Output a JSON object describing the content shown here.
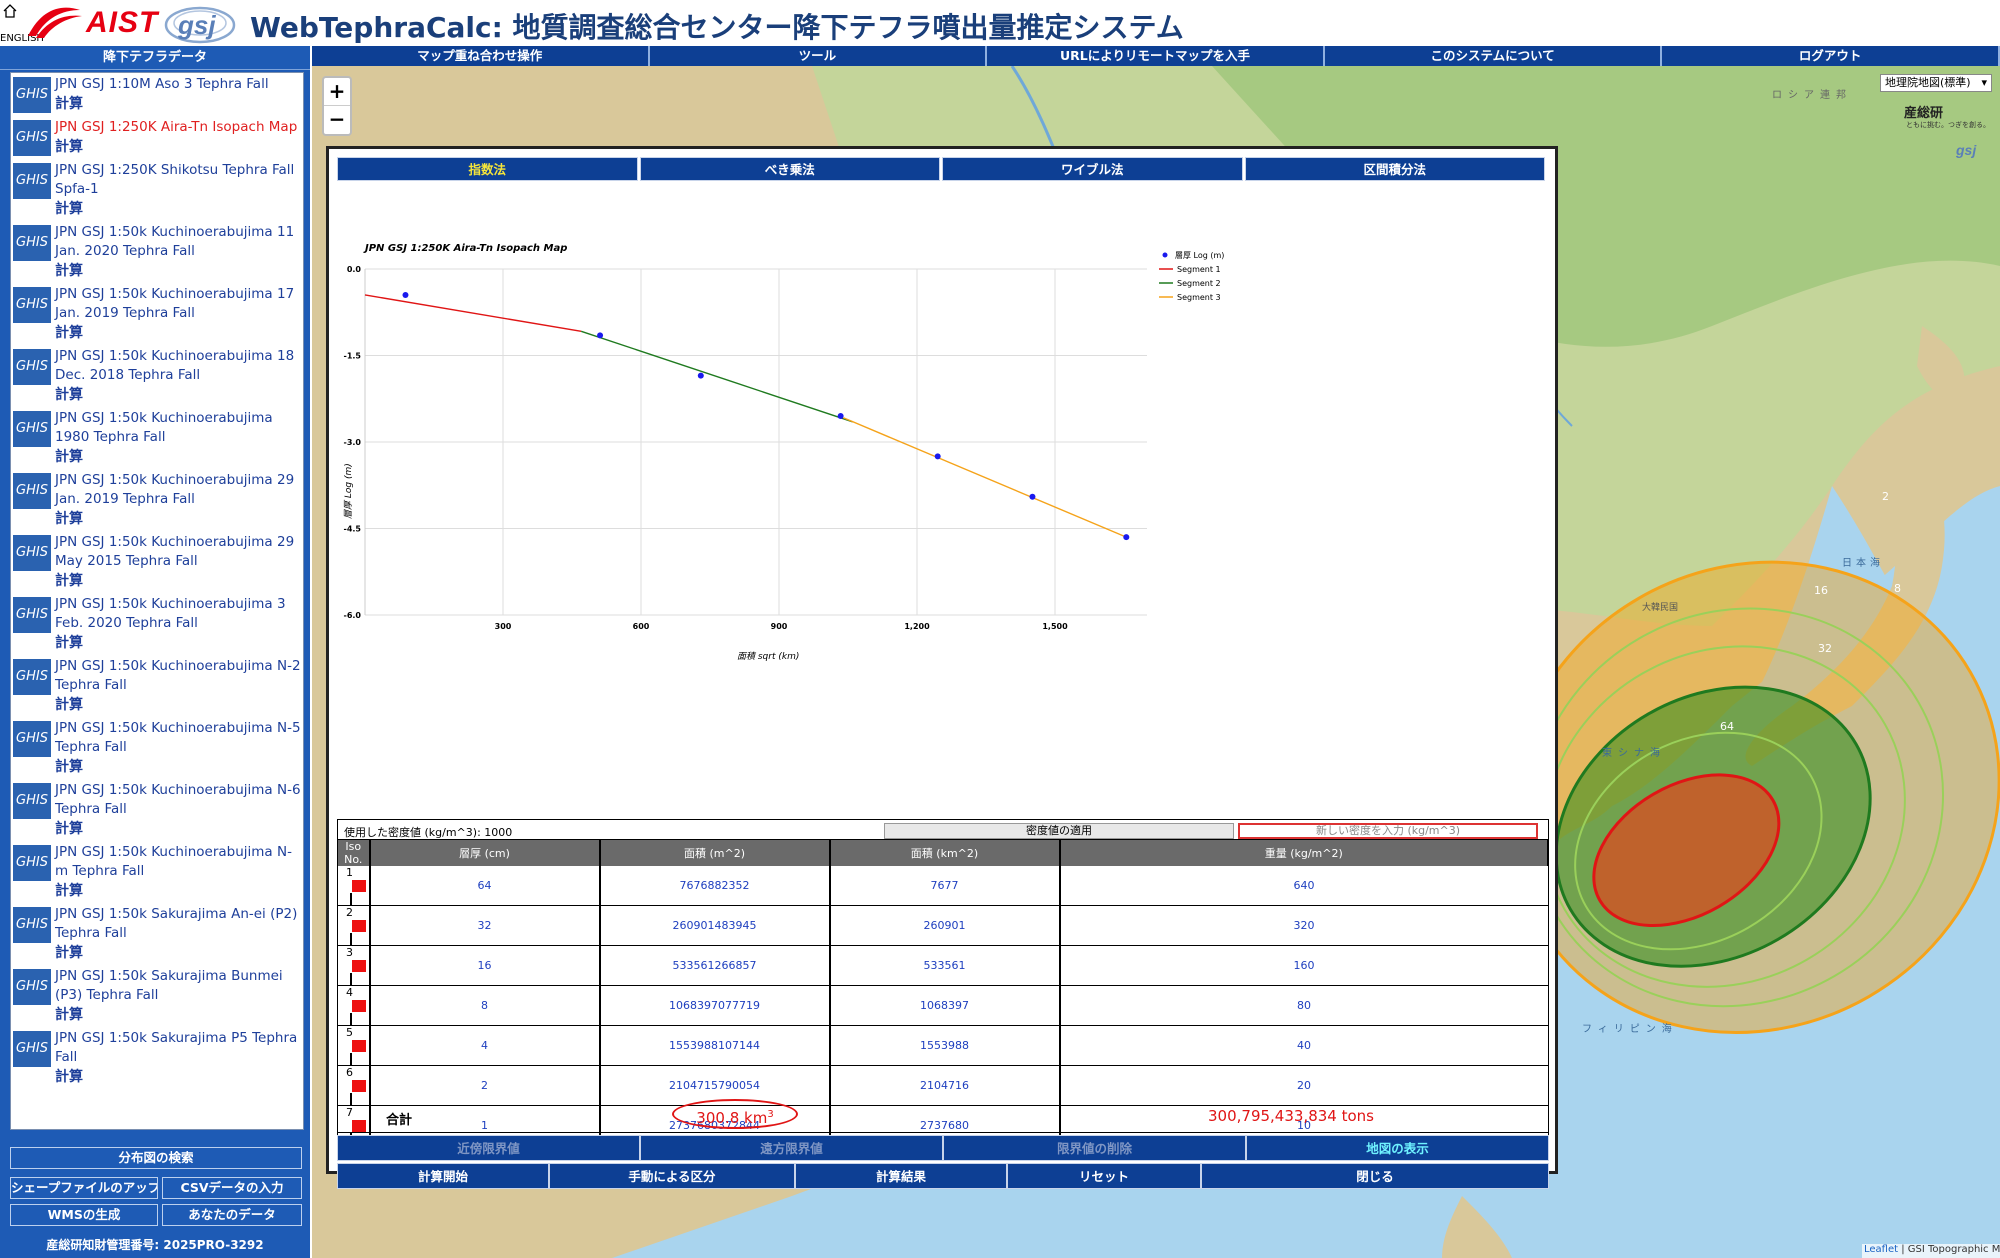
{
  "header": {
    "english": "ENGLISH",
    "aist": "AIST",
    "gsj": "gsj",
    "title": "WebTephraCalc: 地質調査総合センター降下テフラ噴出量推定システム"
  },
  "sidebar": {
    "title": "降下テフラデータ",
    "calc_label": "計算",
    "ghis_label": "GHIS",
    "items": [
      {
        "name": "JPN GSJ 1:10M Aso 3 Tephra Fall"
      },
      {
        "name": "JPN GSJ 1:250K Aira-Tn Isopach Map",
        "selected": true
      },
      {
        "name": "JPN GSJ 1:250K Shikotsu Tephra Fall Spfa-1"
      },
      {
        "name": "JPN GSJ 1:50k Kuchinoerabujima 11 Jan. 2020 Tephra Fall"
      },
      {
        "name": "JPN GSJ 1:50k Kuchinoerabujima 17 Jan. 2019 Tephra Fall"
      },
      {
        "name": "JPN GSJ 1:50k Kuchinoerabujima 18 Dec. 2018 Tephra Fall"
      },
      {
        "name": "JPN GSJ 1:50k Kuchinoerabujima 1980 Tephra Fall"
      },
      {
        "name": "JPN GSJ 1:50k Kuchinoerabujima 29 Jan. 2019 Tephra Fall"
      },
      {
        "name": "JPN GSJ 1:50k Kuchinoerabujima 29 May 2015 Tephra Fall"
      },
      {
        "name": "JPN GSJ 1:50k Kuchinoerabujima 3 Feb. 2020 Tephra Fall"
      },
      {
        "name": "JPN GSJ 1:50k Kuchinoerabujima N-2 Tephra Fall"
      },
      {
        "name": "JPN GSJ 1:50k Kuchinoerabujima N-5 Tephra Fall"
      },
      {
        "name": "JPN GSJ 1:50k Kuchinoerabujima N-6 Tephra Fall"
      },
      {
        "name": "JPN GSJ 1:50k Kuchinoerabujima N-m Tephra Fall"
      },
      {
        "name": "JPN GSJ 1:50k Sakurajima An-ei (P2) Tephra Fall"
      },
      {
        "name": "JPN GSJ 1:50k Sakurajima Bunmei (P3) Tephra Fall"
      },
      {
        "name": "JPN GSJ 1:50k Sakurajima P5 Tephra Fall"
      }
    ],
    "search_button": "分布図の検索",
    "shapefile_button": "シェープファイルのアップロード",
    "csv_button": "CSVデータの入力",
    "wms_button": "WMSの生成",
    "yourdata_button": "あなたのデータ",
    "license": "産総研知財管理番号: 2025PRO-3292"
  },
  "topmenu": [
    "マップ重ね合わせ操作",
    "ツール",
    "URLによりリモートマップを入手",
    "このシステムについて",
    "ログアウト"
  ],
  "map": {
    "layer_select": "地理院地図(標準)",
    "aist_mini": "産総研",
    "aist_mini_sub": "ともに挑む。つぎを創る。",
    "gsj_mini": "gsj",
    "attribution_leaflet": "Leaflet",
    "attribution_rest": " | GSI Topographic Map",
    "zoom_in": "+",
    "zoom_out": "−",
    "contour_labels": [
      "2",
      "16",
      "8",
      "32",
      "64"
    ],
    "place_labels": [
      "ロシア連邦",
      "日本海",
      "東シナ海",
      "フィリピン海",
      "大韓民国"
    ]
  },
  "panel": {
    "tabs": [
      {
        "label": "指数法",
        "active": true
      },
      {
        "label": "べき乗法"
      },
      {
        "label": "ワイブル法"
      },
      {
        "label": "区間積分法"
      }
    ],
    "density_label": "使用した密度値 (kg/m^3): 1000",
    "apply_density": "密度値の適用",
    "new_density_placeholder": "新しい密度を入力 (kg/m^3)",
    "table": {
      "headers": [
        "Iso No.",
        "層厚 (cm)",
        "面積 (m^2)",
        "面積 (km^2)",
        "重量 (kg/m^2)"
      ],
      "rows": [
        {
          "iso": "1",
          "thickness": "64",
          "area_m2": "7676882352",
          "area_km2": "7677",
          "weight": "640"
        },
        {
          "iso": "2",
          "thickness": "32",
          "area_m2": "260901483945",
          "area_km2": "260901",
          "weight": "320"
        },
        {
          "iso": "3",
          "thickness": "16",
          "area_m2": "533561266857",
          "area_km2": "533561",
          "weight": "160"
        },
        {
          "iso": "4",
          "thickness": "8",
          "area_m2": "1068397077719",
          "area_km2": "1068397",
          "weight": "80"
        },
        {
          "iso": "5",
          "thickness": "4",
          "area_m2": "1553988107144",
          "area_km2": "1553988",
          "weight": "40"
        },
        {
          "iso": "6",
          "thickness": "2",
          "area_m2": "2104715790054",
          "area_km2": "2104716",
          "weight": "20"
        },
        {
          "iso": "7",
          "thickness": "1",
          "area_m2": "2737680372844",
          "area_km2": "2737680",
          "weight": "10"
        }
      ]
    },
    "total_label": "合計",
    "total_volume": "300.8 km",
    "total_volume_exp": "3",
    "total_mass": "300,795,433,834 tons",
    "buttons_row1": [
      {
        "label": "近傍限界値",
        "enabled": false
      },
      {
        "label": "遠方限界値",
        "enabled": false
      },
      {
        "label": "限界値の削除",
        "enabled": false
      },
      {
        "label": "地図の表示",
        "enabled": true
      }
    ],
    "buttons_row2": [
      "計算開始",
      "手動による区分",
      "計算結果",
      "リセット",
      "閉じる"
    ]
  },
  "chart_data": {
    "type": "line",
    "title": "JPN GSJ 1:250K Aira-Tn Isopach Map",
    "xlabel": "面積 sqrt (km)",
    "ylabel": "層厚 Log (m)",
    "xlim": [
      0,
      1700
    ],
    "ylim": [
      -6.0,
      0.0
    ],
    "xticks": [
      "300",
      "600",
      "900",
      "1,200",
      "1,500"
    ],
    "xtick_values": [
      300,
      600,
      900,
      1200,
      1500
    ],
    "yticks": [
      "0.0",
      "-1.5",
      "-3.0",
      "-4.5",
      "-6.0"
    ],
    "ytick_values": [
      0.0,
      -1.5,
      -3.0,
      -4.5,
      -6.0
    ],
    "grid": true,
    "legend_position": "top-right",
    "points": {
      "name": "層厚 Log (m)",
      "color": "#1a1aee",
      "x": [
        88,
        511,
        730,
        1034,
        1245,
        1451,
        1655
      ],
      "y": [
        -0.45,
        -1.15,
        -1.85,
        -2.55,
        -3.25,
        -3.95,
        -4.65
      ]
    },
    "series": [
      {
        "name": "Segment 1",
        "color": "#e01515",
        "x": [
          0,
          470
        ],
        "y": [
          -0.45,
          -1.08
        ]
      },
      {
        "name": "Segment 2",
        "color": "#1f7a1f",
        "x": [
          470,
          1060
        ],
        "y": [
          -1.08,
          -2.65
        ]
      },
      {
        "name": "Segment 3",
        "color": "#f5a31a",
        "x": [
          1040,
          1655
        ],
        "y": [
          -2.58,
          -4.65
        ]
      }
    ]
  }
}
